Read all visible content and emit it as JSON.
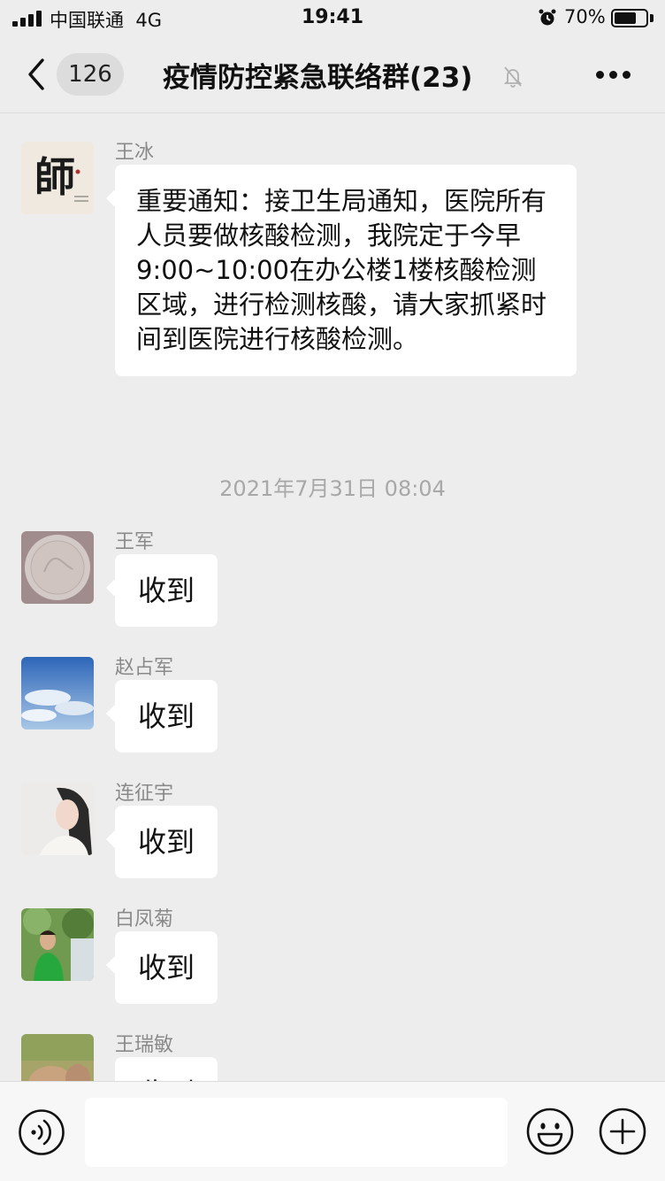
{
  "status_bar": {
    "carrier": "中国联通",
    "network": "4G",
    "time": "19:41",
    "battery_percent": "70%",
    "battery_level": 0.7
  },
  "nav": {
    "unread_count": "126",
    "title": "疫情防控紧急联络群(23)",
    "muted": true
  },
  "messages": [
    {
      "sender": "王冰",
      "text": "重要通知：接卫生局通知，医院所有人员要做核酸检测，我院定于今早9:00~10:00在办公楼1楼核酸检测区域，进行检测核酸，请大家抓紧时间到医院进行核酸检测。",
      "avatar_logo_text": "師"
    },
    {
      "timestamp": "2021年7月31日 08:04"
    },
    {
      "sender": "王军",
      "text": "收到"
    },
    {
      "sender": "赵占军",
      "text": "收到"
    },
    {
      "sender": "连征宇",
      "text": "收到"
    },
    {
      "sender": "白凤菊",
      "text": "收到"
    },
    {
      "sender": "王瑞敏",
      "text": "收到"
    }
  ],
  "input_bar": {
    "input_value": ""
  },
  "colors": {
    "background": "#ededed",
    "bubble": "#ffffff",
    "sender_name": "#8a8a8a",
    "timestamp": "#a8a8a8"
  },
  "icons": [
    "signal-icon",
    "alarm-icon",
    "battery-icon",
    "back-chevron-icon",
    "mute-bell-icon",
    "more-dots-icon",
    "voice-icon",
    "emoji-icon",
    "plus-icon"
  ]
}
